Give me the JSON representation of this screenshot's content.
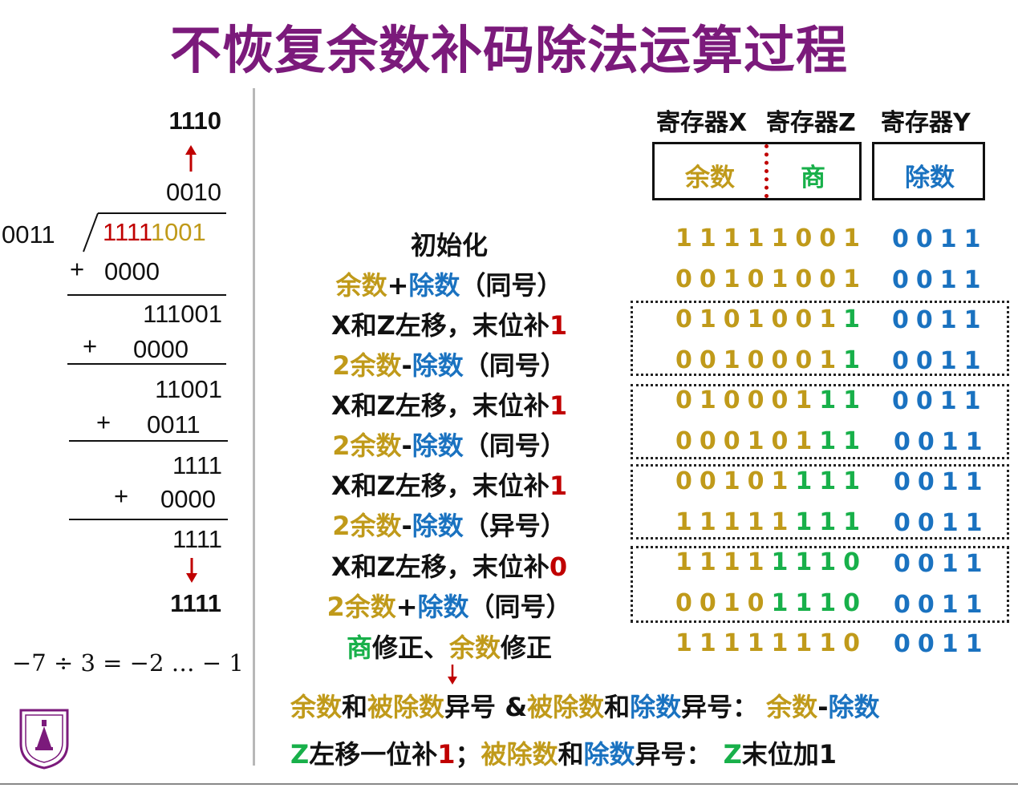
{
  "title": "不恢复余数补码除法运算过程",
  "long_division": {
    "q_result": "1110",
    "q_shift": "0010",
    "divisor": "0011",
    "dividend_red": "1111",
    "dividend_gold": "1001",
    "plus": "+",
    "add1": "0000",
    "r1": "111001",
    "add2": "0000",
    "r2": "11001",
    "add3": "0011",
    "r3": "1111",
    "add4": "0000",
    "r4": "1111",
    "rem_result": "1111",
    "equation": "−7 ÷ 3 = −2 … − 1"
  },
  "registers": {
    "x_label": "寄存器X",
    "z_label": "寄存器Z",
    "y_label": "寄存器Y",
    "rem_cell": "余数",
    "quot_cell": "商",
    "div_cell": "除数"
  },
  "steps": [
    {
      "p1": "初始化",
      "p2": "",
      "p3": "",
      "p4": "",
      "p5": "",
      "x": "11111001",
      "z": "",
      "y": "0011"
    },
    {
      "p1": "余数",
      "p2": "+",
      "p3": "除数",
      "p4": "（同号）",
      "p5": "",
      "x": "00101001",
      "z": "",
      "y": "0011"
    },
    {
      "p1": "X和Z左移，末位补",
      "p2": "1",
      "x": "0101001",
      "z": "1",
      "y": "0011"
    },
    {
      "p1": "2余数",
      "p2": "-",
      "p3": "除数",
      "p4": "（同号）",
      "x": "0010001",
      "z": "1",
      "y": "0011"
    },
    {
      "p1": "X和Z左移，末位补",
      "p2": "1",
      "x": "010001",
      "z": "11",
      "y": "0011"
    },
    {
      "p1": "2余数",
      "p2": "-",
      "p3": "除数",
      "p4": "（同号）",
      "x": "000101",
      "z": "11",
      "y": "0011"
    },
    {
      "p1": "X和Z左移，末位补",
      "p2": "1",
      "x": "00101",
      "z": "111",
      "y": "0011"
    },
    {
      "p1": "2余数",
      "p2": "-",
      "p3": "除数",
      "p4": "（异号）",
      "x": "11111",
      "z": "111",
      "y": "0011"
    },
    {
      "p1": "X和Z左移，末位补",
      "p2": "0",
      "x": "1111",
      "z": "1110",
      "y": "0011"
    },
    {
      "p1": "2余数",
      "p2": "+",
      "p3": "除数",
      "p4": "（同号）",
      "x": "0010",
      "z": "1110",
      "y": "0011"
    },
    {
      "p1": "商",
      "p2": "修正、",
      "p3": "余数",
      "p4": "修正",
      "x": "1111",
      "z": "1110",
      "y": "0011"
    }
  ],
  "notes": {
    "n1": [
      "余数",
      "和",
      "被除数",
      "异号 &",
      "被除数",
      "和",
      "除数",
      "异号：",
      "余数",
      "-",
      "除数"
    ],
    "n2": [
      "Z",
      "左移一位补",
      "1",
      "；",
      "被除数",
      "和",
      "除数",
      "异号：",
      "Z",
      "末位加1"
    ]
  },
  "colors": {
    "title": "#7b1a7b",
    "gold": "#c09a1a",
    "blue": "#1a72c0",
    "green": "#18b04a",
    "red": "#c00000"
  }
}
